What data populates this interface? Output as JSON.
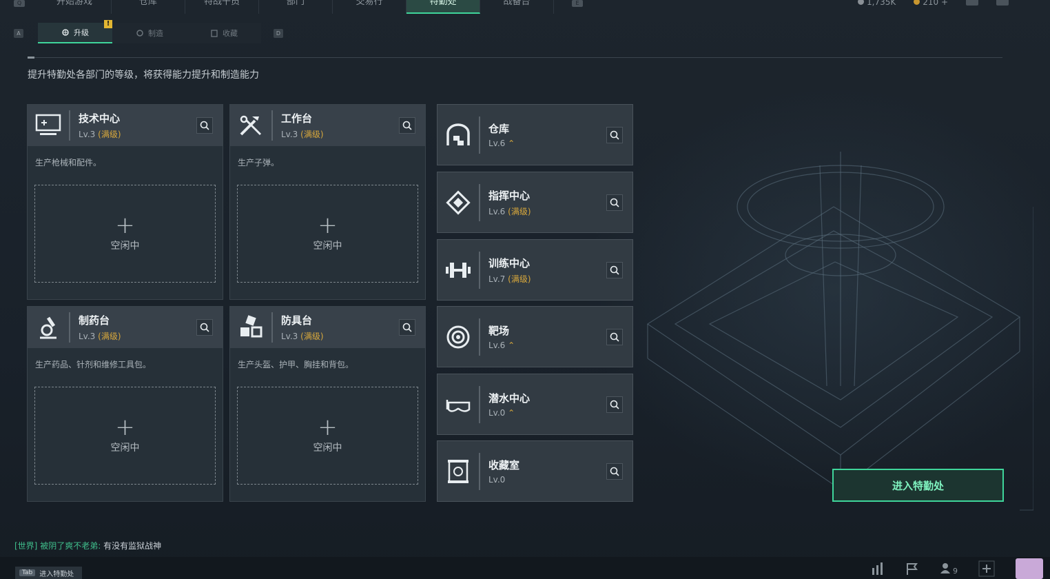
{
  "top_tabs": [
    "开始游戏",
    "仓库",
    "特战干员",
    "部门",
    "交易行",
    "特勤处",
    "战备台"
  ],
  "top_keys": [
    "Q",
    "E"
  ],
  "currency": {
    "silver": "1,735K",
    "gold": "210"
  },
  "subtabs": {
    "key_left": "A",
    "key_right": "D",
    "items": [
      "升级",
      "制造",
      "收藏"
    ],
    "warn": "!"
  },
  "description": "提升特勤处各部门的等级，将获得能力提升和制造能力",
  "big_cards": [
    {
      "title": "技术中心",
      "lv": "Lv.3",
      "status": "(满级)",
      "desc": "生产枪械和配件。",
      "slot": "空闲中"
    },
    {
      "title": "工作台",
      "lv": "Lv.3",
      "status": "(满级)",
      "desc": "生产子弹。",
      "slot": "空闲中"
    },
    {
      "title": "制药台",
      "lv": "Lv.3",
      "status": "(满级)",
      "desc": "生产药品、针剂和维修工具包。",
      "slot": "空闲中"
    },
    {
      "title": "防具台",
      "lv": "Lv.3",
      "status": "(满级)",
      "desc": "生产头盔、护甲、胸挂和背包。",
      "slot": "空闲中"
    }
  ],
  "small_cards": [
    {
      "title": "仓库",
      "lv": "Lv.6",
      "status": ""
    },
    {
      "title": "指挥中心",
      "lv": "Lv.6",
      "status": "(满级)"
    },
    {
      "title": "训练中心",
      "lv": "Lv.7",
      "status": "(满级)"
    },
    {
      "title": "靶场",
      "lv": "Lv.6",
      "status": ""
    },
    {
      "title": "潜水中心",
      "lv": "Lv.0",
      "status": ""
    },
    {
      "title": "收藏室",
      "lv": "Lv.0",
      "status": ""
    }
  ],
  "enter_button": "进入特勤处",
  "chat": {
    "channel": "[世界]",
    "name": "被阴了爽不老弟:",
    "message": "有没有监狱战神"
  },
  "tab_hint": {
    "key": "Tab",
    "label": "进入特勤处"
  },
  "friends_count": "9",
  "colors": {
    "accent": "#3fd69b",
    "max_level": "#d8a83c"
  }
}
